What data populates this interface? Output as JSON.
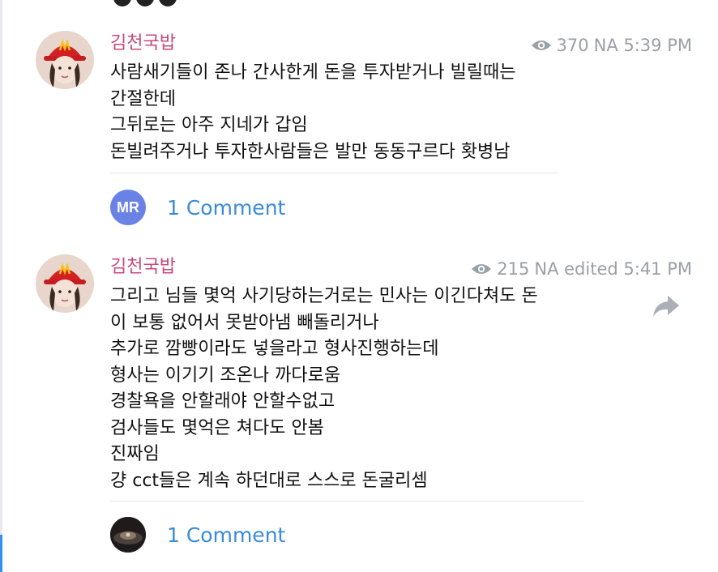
{
  "posts": [
    {
      "author": "김천국밥",
      "views": "370",
      "meta_text": "NA 5:39 PM",
      "lines": [
        "사람새기들이 존나 간사한게 돈을 투자받거나 빌릴때는",
        "간절한데",
        "그뒤로는 아주 지네가 갑임",
        "돈빌려주거나 투자한사람들은 발만 동동구르다 홧병남"
      ],
      "comments": {
        "avatar_initials": "MR",
        "avatar_color": "#6a82e6",
        "label": "1 Comment"
      }
    },
    {
      "author": "김천국밥",
      "views": "215",
      "meta_text": "NA edited 5:41 PM",
      "lines": [
        "그리고 님들 몇억 사기당하는거로는 민사는 이긴다쳐도 돈",
        "이 보통 없어서 못받아냄 빼돌리거나",
        "추가로 깜빵이라도 넣을라고 형사진행하는데",
        "형사는 이기기 조온나 까다로움",
        "경찰욕을 안할래야 안할수없고",
        "검사들도 몇억은 쳐다도 안봄",
        "진짜임",
        "걍 cct들은 계속 하던대로 스스로 돈굴리셈"
      ],
      "comments": {
        "label": "1 Comment"
      }
    }
  ],
  "icons": {
    "views": "eye-icon",
    "share": "share-arrow-icon"
  }
}
